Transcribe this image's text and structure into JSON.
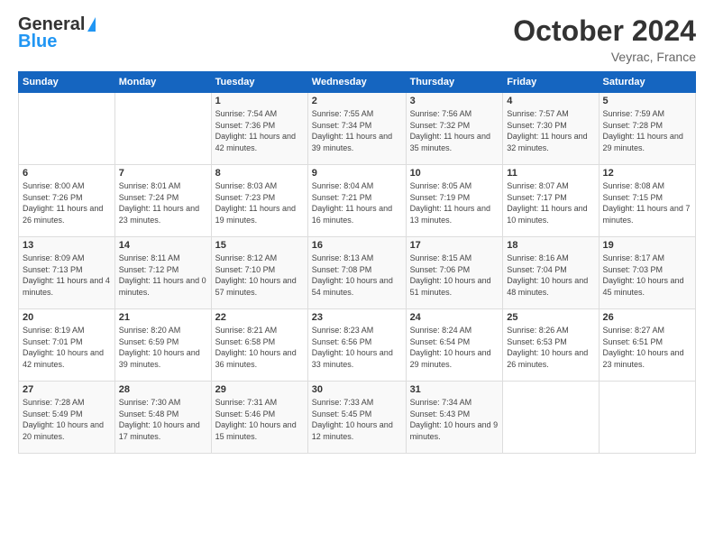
{
  "header": {
    "logo_general": "General",
    "logo_blue": "Blue",
    "month": "October 2024",
    "location": "Veyrac, France"
  },
  "columns": [
    "Sunday",
    "Monday",
    "Tuesday",
    "Wednesday",
    "Thursday",
    "Friday",
    "Saturday"
  ],
  "weeks": [
    [
      {
        "day": "",
        "info": ""
      },
      {
        "day": "",
        "info": ""
      },
      {
        "day": "1",
        "info": "Sunrise: 7:54 AM\nSunset: 7:36 PM\nDaylight: 11 hours and 42 minutes."
      },
      {
        "day": "2",
        "info": "Sunrise: 7:55 AM\nSunset: 7:34 PM\nDaylight: 11 hours and 39 minutes."
      },
      {
        "day": "3",
        "info": "Sunrise: 7:56 AM\nSunset: 7:32 PM\nDaylight: 11 hours and 35 minutes."
      },
      {
        "day": "4",
        "info": "Sunrise: 7:57 AM\nSunset: 7:30 PM\nDaylight: 11 hours and 32 minutes."
      },
      {
        "day": "5",
        "info": "Sunrise: 7:59 AM\nSunset: 7:28 PM\nDaylight: 11 hours and 29 minutes."
      }
    ],
    [
      {
        "day": "6",
        "info": "Sunrise: 8:00 AM\nSunset: 7:26 PM\nDaylight: 11 hours and 26 minutes."
      },
      {
        "day": "7",
        "info": "Sunrise: 8:01 AM\nSunset: 7:24 PM\nDaylight: 11 hours and 23 minutes."
      },
      {
        "day": "8",
        "info": "Sunrise: 8:03 AM\nSunset: 7:23 PM\nDaylight: 11 hours and 19 minutes."
      },
      {
        "day": "9",
        "info": "Sunrise: 8:04 AM\nSunset: 7:21 PM\nDaylight: 11 hours and 16 minutes."
      },
      {
        "day": "10",
        "info": "Sunrise: 8:05 AM\nSunset: 7:19 PM\nDaylight: 11 hours and 13 minutes."
      },
      {
        "day": "11",
        "info": "Sunrise: 8:07 AM\nSunset: 7:17 PM\nDaylight: 11 hours and 10 minutes."
      },
      {
        "day": "12",
        "info": "Sunrise: 8:08 AM\nSunset: 7:15 PM\nDaylight: 11 hours and 7 minutes."
      }
    ],
    [
      {
        "day": "13",
        "info": "Sunrise: 8:09 AM\nSunset: 7:13 PM\nDaylight: 11 hours and 4 minutes."
      },
      {
        "day": "14",
        "info": "Sunrise: 8:11 AM\nSunset: 7:12 PM\nDaylight: 11 hours and 0 minutes."
      },
      {
        "day": "15",
        "info": "Sunrise: 8:12 AM\nSunset: 7:10 PM\nDaylight: 10 hours and 57 minutes."
      },
      {
        "day": "16",
        "info": "Sunrise: 8:13 AM\nSunset: 7:08 PM\nDaylight: 10 hours and 54 minutes."
      },
      {
        "day": "17",
        "info": "Sunrise: 8:15 AM\nSunset: 7:06 PM\nDaylight: 10 hours and 51 minutes."
      },
      {
        "day": "18",
        "info": "Sunrise: 8:16 AM\nSunset: 7:04 PM\nDaylight: 10 hours and 48 minutes."
      },
      {
        "day": "19",
        "info": "Sunrise: 8:17 AM\nSunset: 7:03 PM\nDaylight: 10 hours and 45 minutes."
      }
    ],
    [
      {
        "day": "20",
        "info": "Sunrise: 8:19 AM\nSunset: 7:01 PM\nDaylight: 10 hours and 42 minutes."
      },
      {
        "day": "21",
        "info": "Sunrise: 8:20 AM\nSunset: 6:59 PM\nDaylight: 10 hours and 39 minutes."
      },
      {
        "day": "22",
        "info": "Sunrise: 8:21 AM\nSunset: 6:58 PM\nDaylight: 10 hours and 36 minutes."
      },
      {
        "day": "23",
        "info": "Sunrise: 8:23 AM\nSunset: 6:56 PM\nDaylight: 10 hours and 33 minutes."
      },
      {
        "day": "24",
        "info": "Sunrise: 8:24 AM\nSunset: 6:54 PM\nDaylight: 10 hours and 29 minutes."
      },
      {
        "day": "25",
        "info": "Sunrise: 8:26 AM\nSunset: 6:53 PM\nDaylight: 10 hours and 26 minutes."
      },
      {
        "day": "26",
        "info": "Sunrise: 8:27 AM\nSunset: 6:51 PM\nDaylight: 10 hours and 23 minutes."
      }
    ],
    [
      {
        "day": "27",
        "info": "Sunrise: 7:28 AM\nSunset: 5:49 PM\nDaylight: 10 hours and 20 minutes."
      },
      {
        "day": "28",
        "info": "Sunrise: 7:30 AM\nSunset: 5:48 PM\nDaylight: 10 hours and 17 minutes."
      },
      {
        "day": "29",
        "info": "Sunrise: 7:31 AM\nSunset: 5:46 PM\nDaylight: 10 hours and 15 minutes."
      },
      {
        "day": "30",
        "info": "Sunrise: 7:33 AM\nSunset: 5:45 PM\nDaylight: 10 hours and 12 minutes."
      },
      {
        "day": "31",
        "info": "Sunrise: 7:34 AM\nSunset: 5:43 PM\nDaylight: 10 hours and 9 minutes."
      },
      {
        "day": "",
        "info": ""
      },
      {
        "day": "",
        "info": ""
      }
    ]
  ]
}
